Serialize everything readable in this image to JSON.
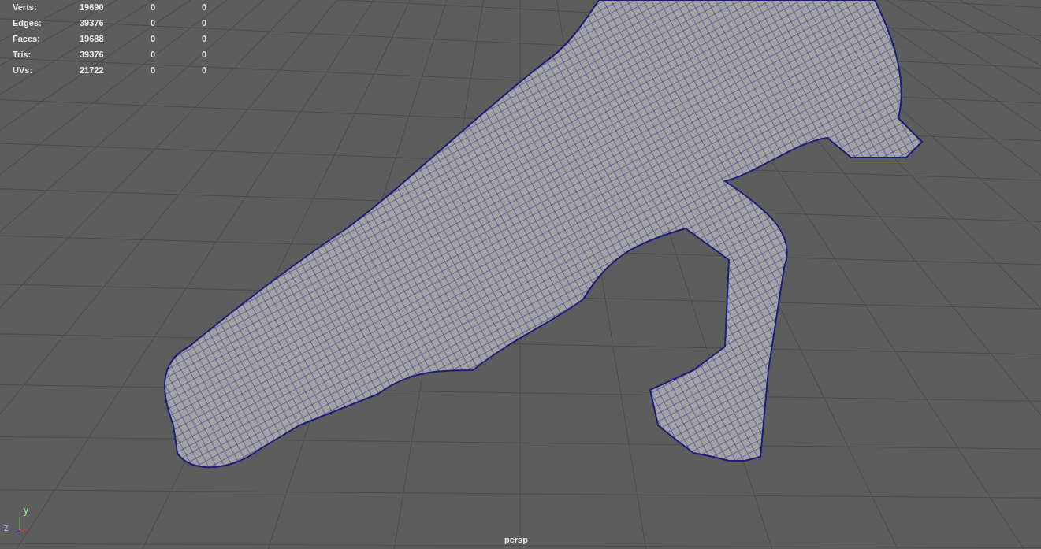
{
  "stats": [
    {
      "label": "Verts:",
      "column_1": "19690",
      "column_2": "0",
      "column_3": "0"
    },
    {
      "label": "Edges:",
      "column_1": "39376",
      "column_2": "0",
      "column_3": "0"
    },
    {
      "label": "Faces:",
      "column_1": "19688",
      "column_2": "0",
      "column_3": "0"
    },
    {
      "label": "Tris:",
      "column_1": "39376",
      "column_2": "0",
      "column_3": "0"
    },
    {
      "label": "UVs:",
      "column_1": "21722",
      "column_2": "0",
      "column_3": "0"
    }
  ],
  "axis_gizmo": {
    "y_label": "y",
    "z_label": "z"
  },
  "camera_label": "persp"
}
